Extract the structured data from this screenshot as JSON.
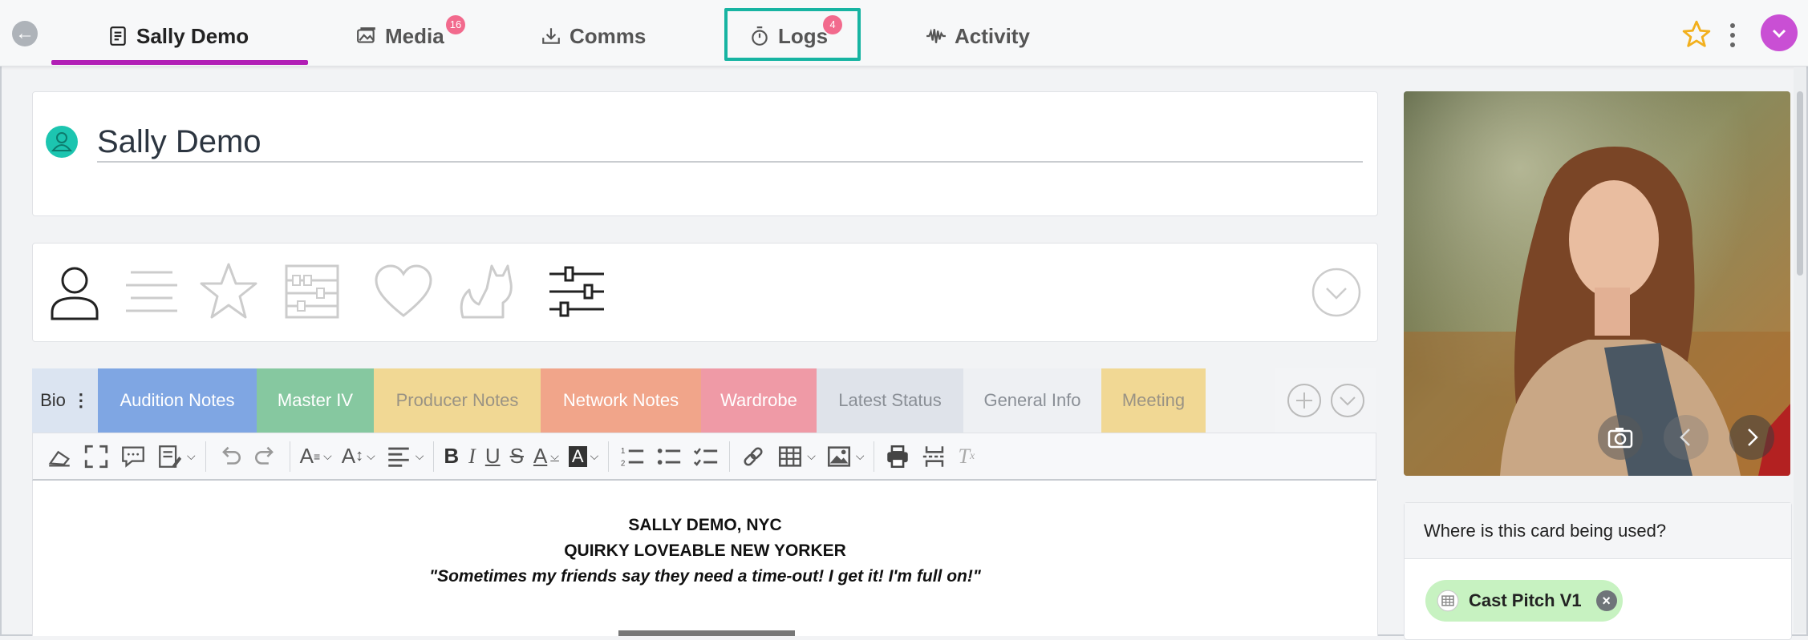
{
  "topnav": {
    "tabs": [
      {
        "label": "Sally Demo",
        "icon": "document-icon",
        "active": true
      },
      {
        "label": "Media",
        "icon": "images-icon",
        "badge": "16"
      },
      {
        "label": "Comms",
        "icon": "download-tray-icon"
      },
      {
        "label": "Logs",
        "icon": "stopwatch-icon",
        "badge": "4"
      },
      {
        "label": "Activity",
        "icon": "waveform-icon"
      }
    ],
    "accent": "#b11eb5",
    "highlight_color": "#17b4a2"
  },
  "profile": {
    "name": "Sally Demo"
  },
  "categories_icons": [
    "person-icon",
    "lines-icon",
    "star-outline-icon",
    "abacus-icon",
    "heart-icon",
    "cat-icon",
    "sliders-icon"
  ],
  "note_tabs": {
    "bio": "Bio",
    "items": [
      "Audition Notes",
      "Master IV",
      "Producer Notes",
      "Network Notes",
      "Wardrobe",
      "Latest Status",
      "General Info",
      "Meeting"
    ]
  },
  "editor": {
    "line1": "SALLY DEMO, NYC",
    "line2": "QUIRKY LOVEABLE NEW YORKER",
    "line3": "\"Sometimes my friends say they need a time-out! I get it! I'm full on!\""
  },
  "usage": {
    "heading": "Where is this card being used?",
    "pill_label": "Cast Pitch V1"
  }
}
